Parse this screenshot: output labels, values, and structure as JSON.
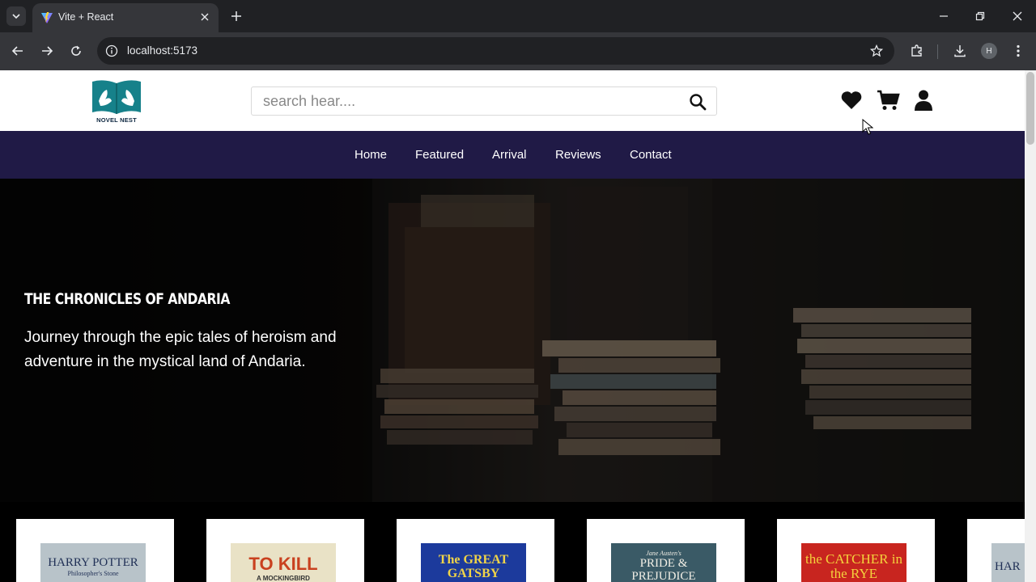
{
  "browser": {
    "tab_title": "Vite + React",
    "url": "localhost:5173",
    "profile_initial": "H"
  },
  "site": {
    "logo_text": "NOVEL NEST",
    "search_placeholder": "search hear....",
    "nav": [
      "Home",
      "Featured",
      "Arrival",
      "Reviews",
      "Contact"
    ]
  },
  "hero": {
    "title": "THE CHRONICLES OF ANDARIA",
    "description": "Journey through the epic tales of heroism and adventure in the mystical land of Andaria."
  },
  "books": [
    {
      "cover_text": "HARRY POTTER",
      "cover_sub": "Philosopher's Stone",
      "bg": "#b8c3c9",
      "fg": "#1f2f55"
    },
    {
      "cover_text": "TO KILL",
      "cover_sub": "A MOCKINGBIRD",
      "bg": "#e9e2c6",
      "fg": "#c9411f"
    },
    {
      "cover_text": "The GREAT GATSBY",
      "cover_sub": "",
      "bg": "#1c3a9c",
      "fg": "#f1d448"
    },
    {
      "cover_text": "PRIDE & PREJUDICE",
      "cover_sub": "Jane Austen's",
      "bg": "#3a5a66",
      "fg": "#f2efe6"
    },
    {
      "cover_text": "the CATCHER in the RYE",
      "cover_sub": "",
      "bg": "#c8251f",
      "fg": "#f4d23c"
    },
    {
      "cover_text": "HAR",
      "cover_sub": "",
      "bg": "#b8c3c9",
      "fg": "#1f2f55"
    }
  ],
  "colors": {
    "nav_bg": "#201a46",
    "logo_teal": "#16818a"
  }
}
